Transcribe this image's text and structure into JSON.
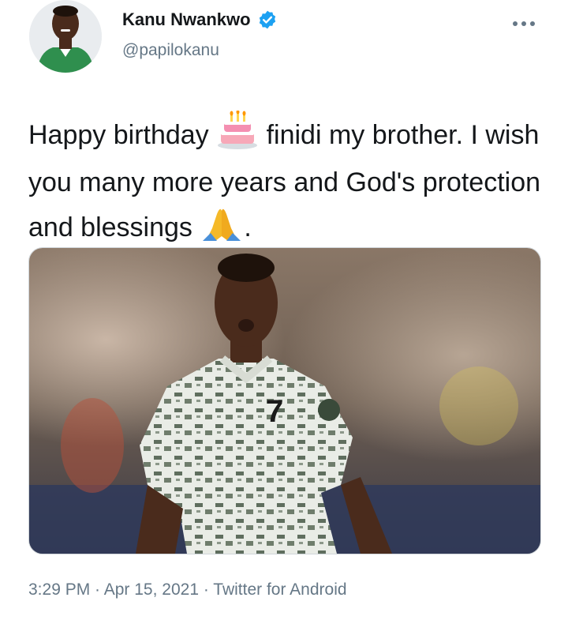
{
  "user": {
    "display_name": "Kanu Nwankwo",
    "handle": "@papilokanu",
    "verified": true
  },
  "more_options_icon": "more-horizontal-icon",
  "tweet": {
    "text_part1": "Happy birthday ",
    "emoji1": "birthday-cake",
    "text_part2": " finidi my brother. I wish you many more years and God's protection and blessings ",
    "emoji2": "folded-hands",
    "text_part3": "."
  },
  "meta": {
    "time": "3:29 PM",
    "date": "Apr 15, 2021",
    "source": "Twitter for Android",
    "separator": " · "
  },
  "colors": {
    "text": "#14171a",
    "secondary": "#657786",
    "verified_blue": "#1da1f2"
  }
}
